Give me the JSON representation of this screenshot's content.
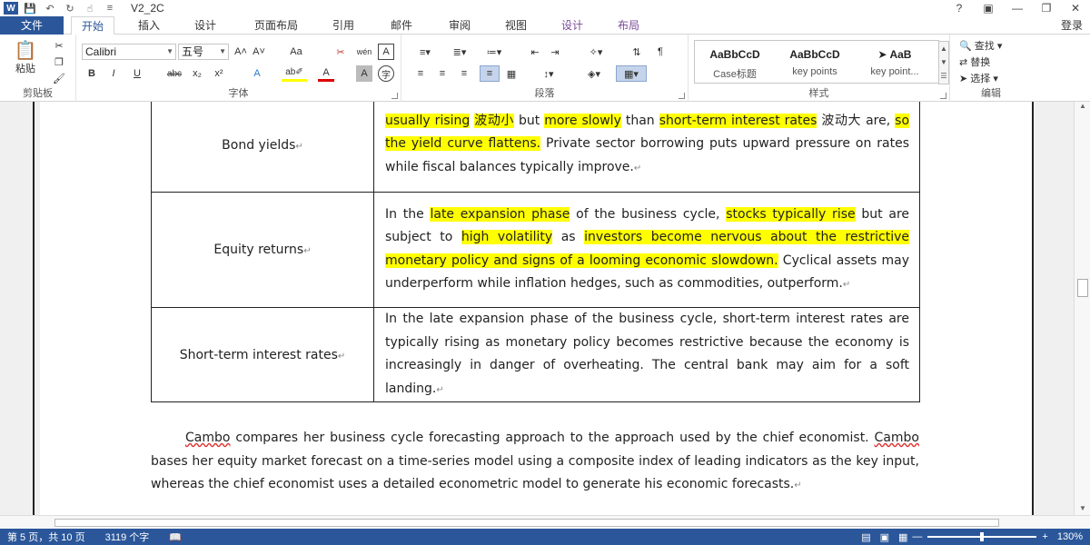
{
  "titlebar": {
    "app_logo": "W",
    "doc_title": "V2_2C",
    "help": "?",
    "ribbon_display": "▣",
    "minimize": "—",
    "restore": "❐",
    "close": "✕",
    "qa_save": "💾",
    "qa_undo": "↶",
    "qa_redo": "↻",
    "qa_touch": "☝",
    "qa_more": "≡"
  },
  "tabs": {
    "file": "文件",
    "items": [
      "开始",
      "插入",
      "设计",
      "页面布局",
      "引用",
      "邮件",
      "审阅",
      "视图",
      "设计",
      "布局"
    ],
    "login": "登录"
  },
  "ribbon": {
    "clipboard": {
      "paste": "粘贴",
      "label": "剪贴板"
    },
    "font": {
      "font_name": "Calibri",
      "font_size": "五号",
      "grow": "A˄",
      "shrink": "A˅",
      "change_case": "Aa",
      "clear_format": "✂",
      "pinyin": "wén",
      "border_char": "A",
      "bold": "B",
      "italic": "I",
      "underline": "U",
      "strike": "abc",
      "subscript": "x₂",
      "superscript": "x²",
      "text_effects": "A",
      "highlight": "ab✐",
      "font_color": "A",
      "char_shading": "A",
      "enclose": "字",
      "label": "字体"
    },
    "paragraph": {
      "label": "段落"
    },
    "styles": {
      "items": [
        {
          "sample": "AaBbCcD",
          "name": "Case标题"
        },
        {
          "sample": "AaBbCcD",
          "name": "key points"
        },
        {
          "sample": "➤ AaB",
          "name": "key point..."
        }
      ],
      "label": "样式"
    },
    "editing": {
      "find": "查找",
      "replace": "替换",
      "select": "选择",
      "label": "编辑"
    }
  },
  "table": {
    "rows": [
      {
        "label": "Bond yields",
        "segments": [
          {
            "t": "usually rising",
            "h": true
          },
          {
            "t": " ",
            "h": false
          },
          {
            "t": "波动小",
            "h": true
          },
          {
            "t": " but ",
            "h": false
          },
          {
            "t": "more slowly",
            "h": true
          },
          {
            "t": " than ",
            "h": false
          },
          {
            "t": "short-term interest rates",
            "h": true
          },
          {
            "t": " 波动大 are, ",
            "h": false
          },
          {
            "t": "so the yield curve flattens.",
            "h": true
          },
          {
            "t": " Private sector borrowing puts upward pressure on rates while fiscal balances typically improve.",
            "h": false
          }
        ]
      },
      {
        "label": "Equity returns",
        "segments": [
          {
            "t": "In the ",
            "h": false
          },
          {
            "t": "late expansion phase",
            "h": true
          },
          {
            "t": " of the business cycle, ",
            "h": false
          },
          {
            "t": "stocks typically rise",
            "h": true
          },
          {
            "t": " but are subject to ",
            "h": false
          },
          {
            "t": "high volatility",
            "h": true
          },
          {
            "t": " as ",
            "h": false
          },
          {
            "t": "investors become nervous about the restrictive monetary policy and signs of a looming economic slowdown.",
            "h": true
          },
          {
            "t": " Cyclical assets may underperform while inflation hedges, such as commodities, outperform.",
            "h": false
          }
        ]
      },
      {
        "label": "Short-term interest rates",
        "segments": [
          {
            "t": "In the late expansion phase of the business cycle, short-term interest rates are typically rising as monetary policy becomes restrictive because the economy is increasingly in danger of overheating. The central bank may aim for a soft landing.",
            "h": false
          }
        ]
      }
    ]
  },
  "paragraph": {
    "name1": "Cambo",
    "text1": " compares her business cycle forecasting approach to the approach used by the chief economist. ",
    "name2": "Cambo",
    "text2": " bases her equity market forecast on a time-series model using a composite index of leading indicators as the key input, whereas the chief economist uses a detailed econometric model to generate his economic forecasts."
  },
  "statusbar": {
    "page": "第 5 页，共 10 页",
    "words": "3119 个字",
    "zoom_minus": "—",
    "zoom_plus": "+",
    "zoom": "130%"
  },
  "colors": {
    "accent": "#2b579a",
    "highlight": "#ffff00"
  }
}
